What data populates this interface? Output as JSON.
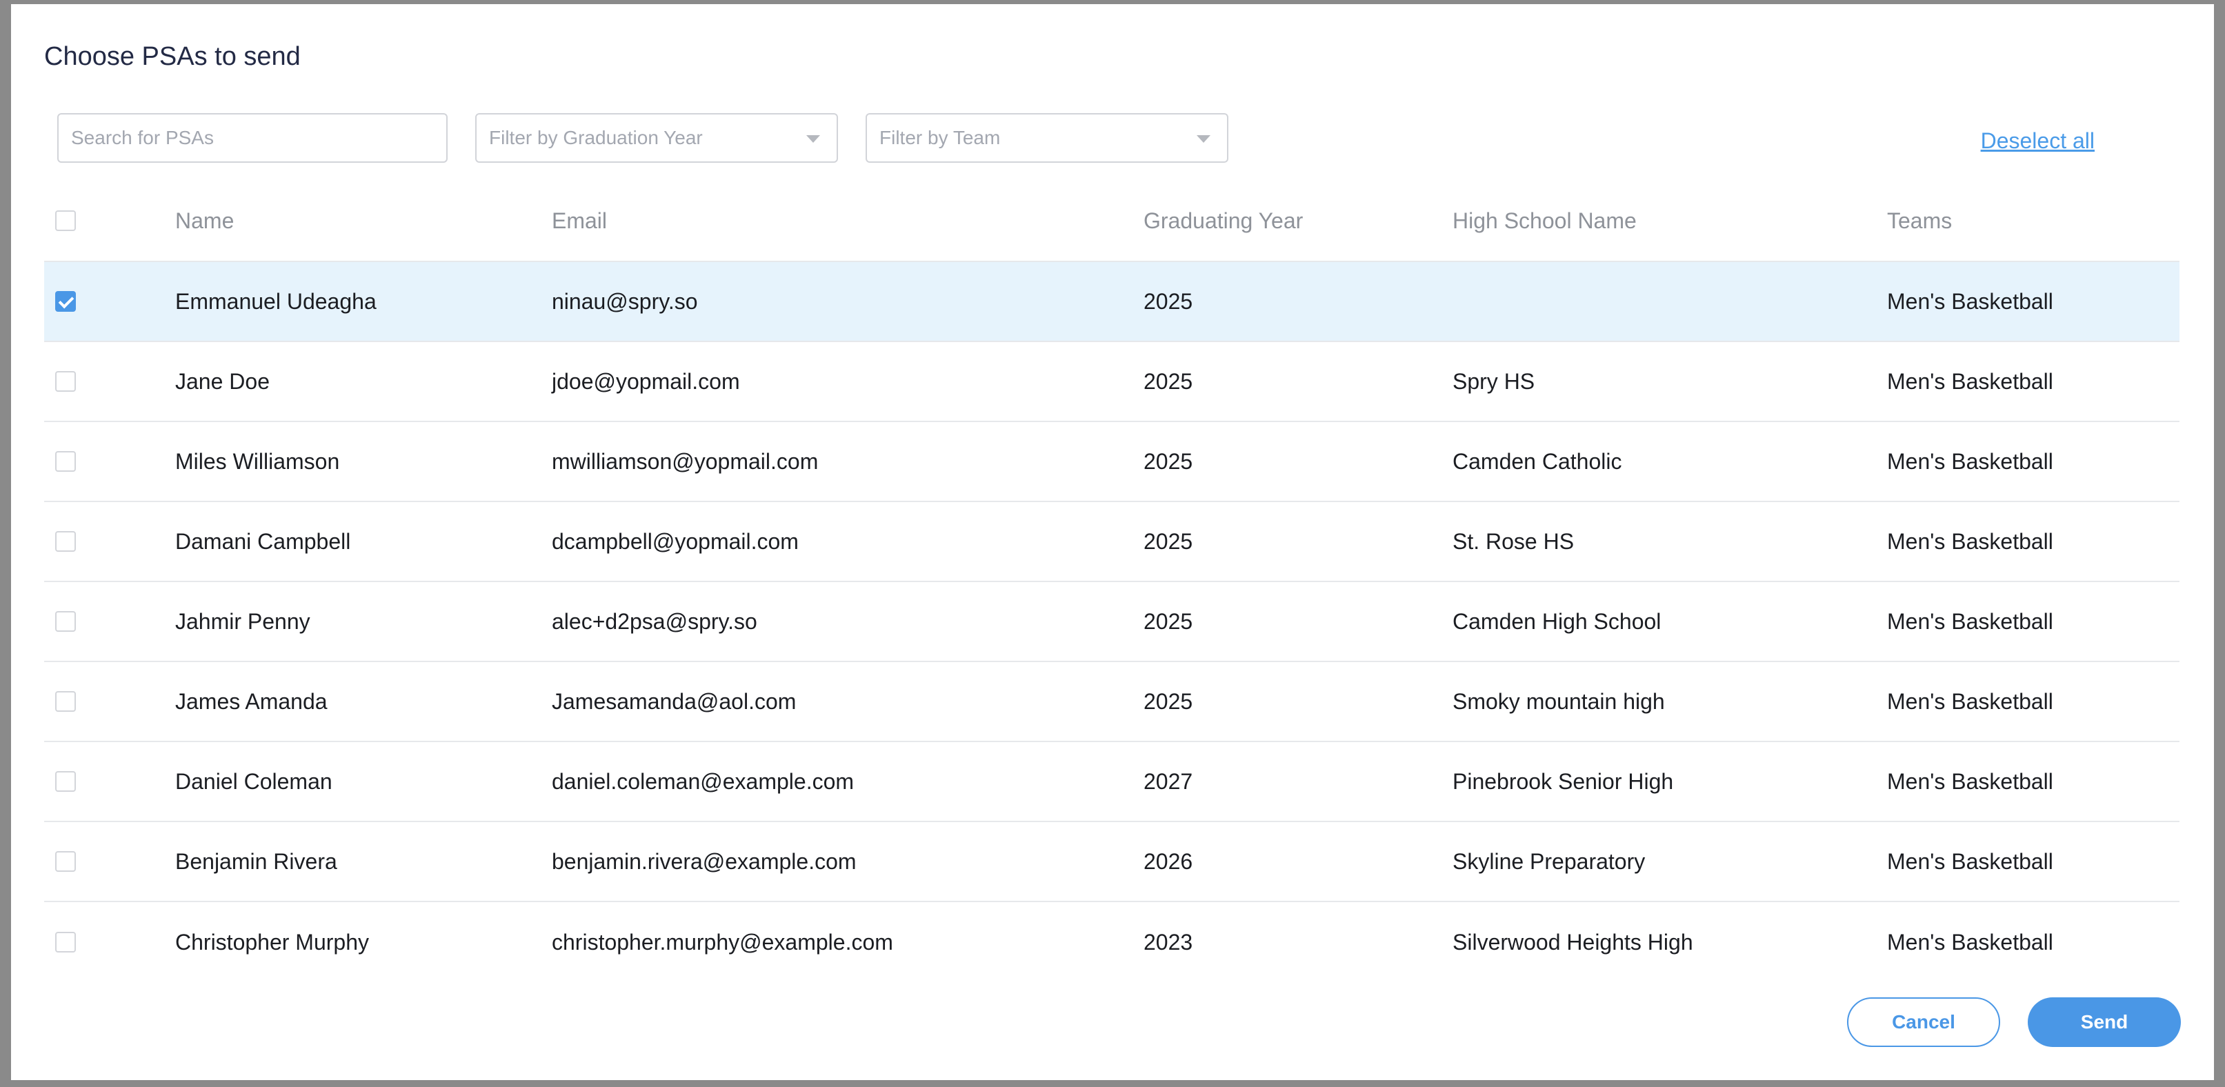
{
  "modal": {
    "title": "Choose PSAs to send"
  },
  "filters": {
    "search_placeholder": "Search for PSAs",
    "grad_year_placeholder": "Filter by Graduation Year",
    "team_placeholder": "Filter by Team",
    "deselect_label": "Deselect all"
  },
  "table": {
    "headers": {
      "name": "Name",
      "email": "Email",
      "year": "Graduating Year",
      "school": "High School Name",
      "teams": "Teams"
    },
    "rows": [
      {
        "selected": true,
        "name": "Emmanuel  Udeagha",
        "email": "ninau@spry.so",
        "year": "2025",
        "school": "",
        "teams": "Men's Basketball"
      },
      {
        "selected": false,
        "name": "Jane Doe",
        "email": "jdoe@yopmail.com",
        "year": "2025",
        "school": "Spry HS",
        "teams": "Men's Basketball"
      },
      {
        "selected": false,
        "name": "Miles Williamson",
        "email": "mwilliamson@yopmail.com",
        "year": "2025",
        "school": "Camden Catholic",
        "teams": "Men's Basketball"
      },
      {
        "selected": false,
        "name": "Damani Campbell",
        "email": "dcampbell@yopmail.com",
        "year": "2025",
        "school": "St. Rose HS",
        "teams": "Men's Basketball"
      },
      {
        "selected": false,
        "name": "Jahmir Penny",
        "email": "alec+d2psa@spry.so",
        "year": "2025",
        "school": "Camden High School",
        "teams": "Men's Basketball"
      },
      {
        "selected": false,
        "name": "James Amanda",
        "email": "Jamesamanda@aol.com",
        "year": "2025",
        "school": "Smoky mountain high",
        "teams": "Men's Basketball"
      },
      {
        "selected": false,
        "name": "Daniel Coleman",
        "email": "daniel.coleman@example.com",
        "year": "2027",
        "school": "Pinebrook Senior High",
        "teams": "Men's Basketball"
      },
      {
        "selected": false,
        "name": "Benjamin Rivera",
        "email": "benjamin.rivera@example.com",
        "year": "2026",
        "school": "Skyline Preparatory",
        "teams": "Men's Basketball"
      },
      {
        "selected": false,
        "name": "Christopher Murphy",
        "email": "christopher.murphy@example.com",
        "year": "2023",
        "school": "Silverwood Heights High",
        "teams": "Men's Basketball"
      }
    ]
  },
  "actions": {
    "cancel_label": "Cancel",
    "send_label": "Send"
  },
  "colors": {
    "accent": "#4a97e6",
    "selected_row": "#e6f3fc",
    "title": "#232a45"
  }
}
